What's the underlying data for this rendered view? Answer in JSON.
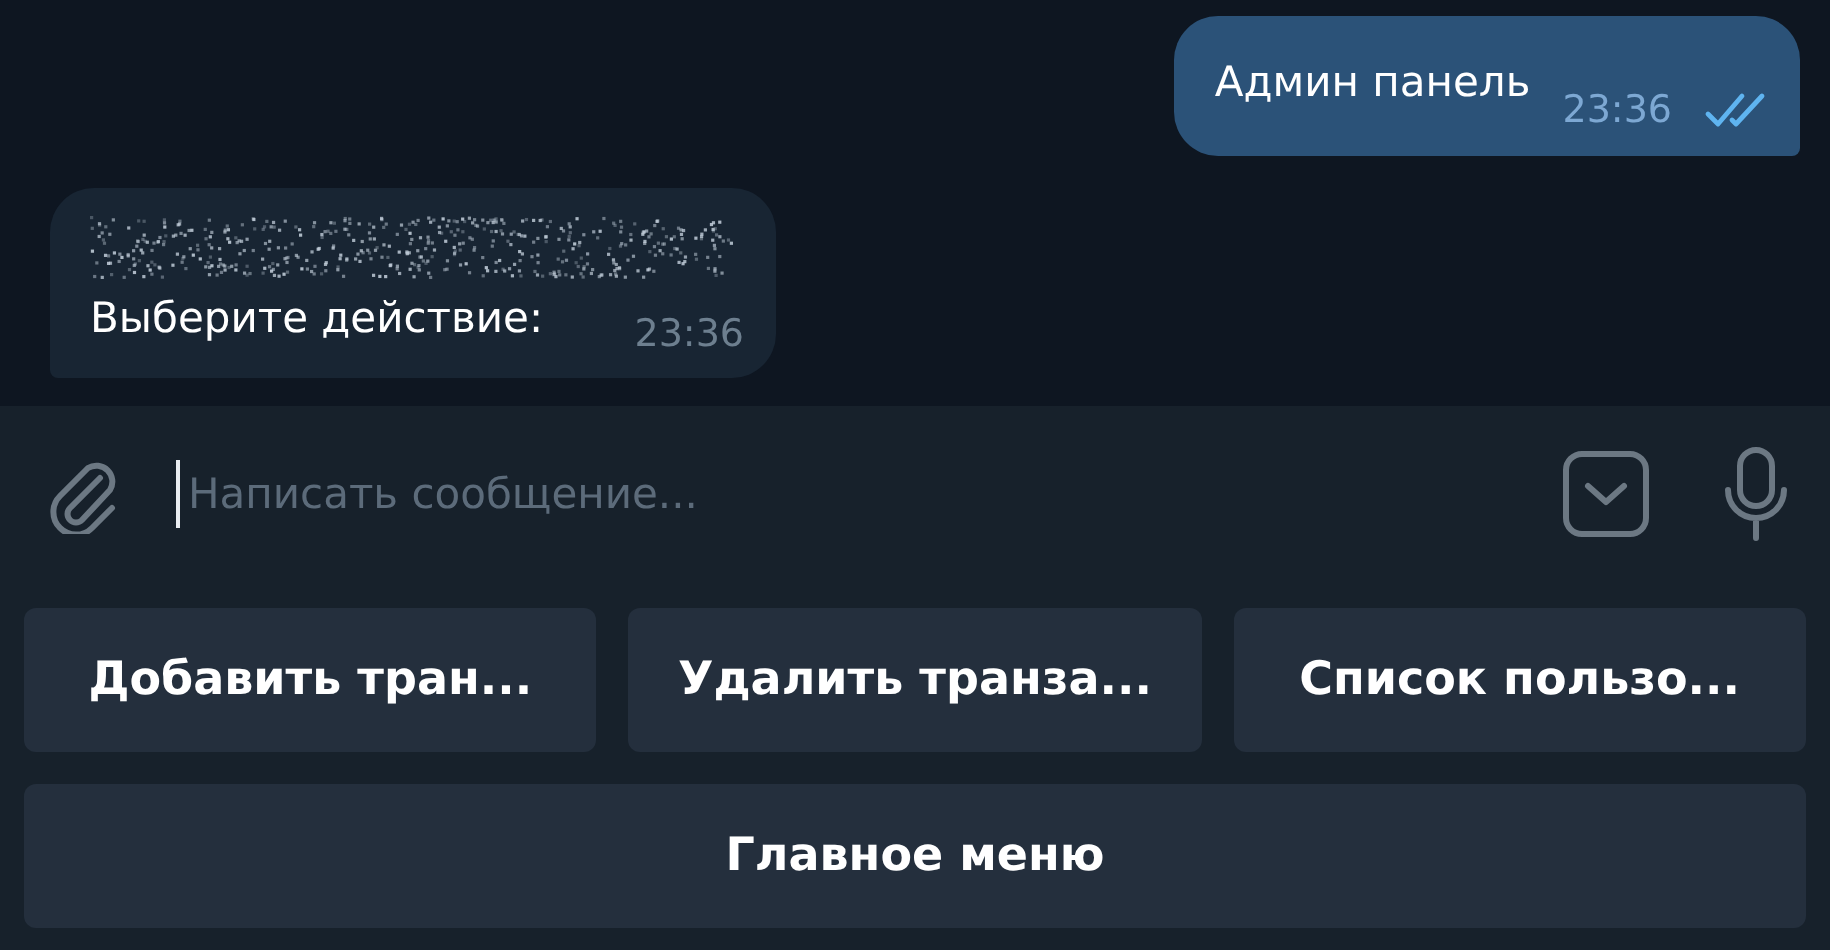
{
  "messages": [
    {
      "kind": "outgoing",
      "text": "Админ панель",
      "time": "23:36",
      "read": true
    },
    {
      "kind": "incoming",
      "spoiler": true,
      "text": "Выберите действие:",
      "time": "23:36"
    }
  ],
  "composer": {
    "placeholder": "Написать сообщение..."
  },
  "keyboard": [
    [
      "Добавить тран...",
      "Удалить транза...",
      "Список пользо..."
    ],
    [
      "Главное меню"
    ]
  ]
}
